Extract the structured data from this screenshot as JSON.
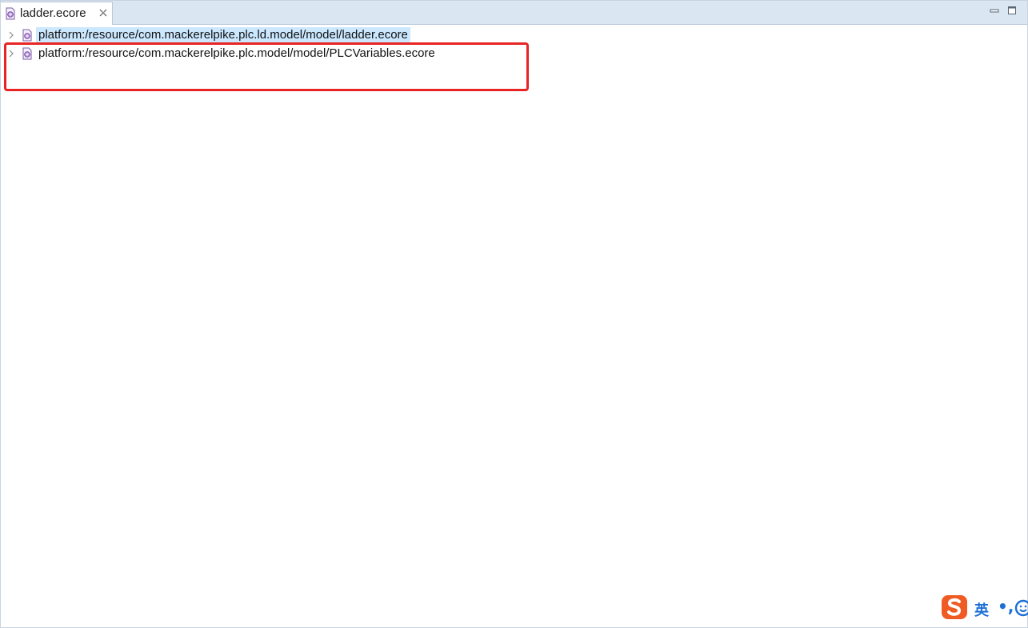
{
  "editor": {
    "tab": {
      "label": "ladder.ecore",
      "icon": "ecore-file-icon",
      "close_icon": "close-icon"
    },
    "window_controls": [
      "minimize-icon",
      "maximize-icon"
    ]
  },
  "tree": {
    "rows": [
      {
        "label": "platform:/resource/com.mackerelpike.plc.ld.model/model/ladder.ecore",
        "selected": true,
        "icon": "ecore-resource-icon",
        "expander": "chevron-right-icon"
      },
      {
        "label": "platform:/resource/com.mackerelpike.plc.model/model/PLCVariables.ecore",
        "selected": false,
        "icon": "ecore-resource-icon",
        "expander": "chevron-right-icon"
      }
    ]
  },
  "annotation": {
    "color": "#e82424"
  },
  "ime_toolbar": {
    "logo": "sogou-logo-icon",
    "lang_label": "英",
    "punct_label": "•,",
    "emoji": "smiley-icon",
    "logo_color": "#f05a23",
    "text_color": "#1d6fd6"
  },
  "colors": {
    "tabbar_bg": "#dbe6f3",
    "selection_bg": "#cce8ff"
  }
}
